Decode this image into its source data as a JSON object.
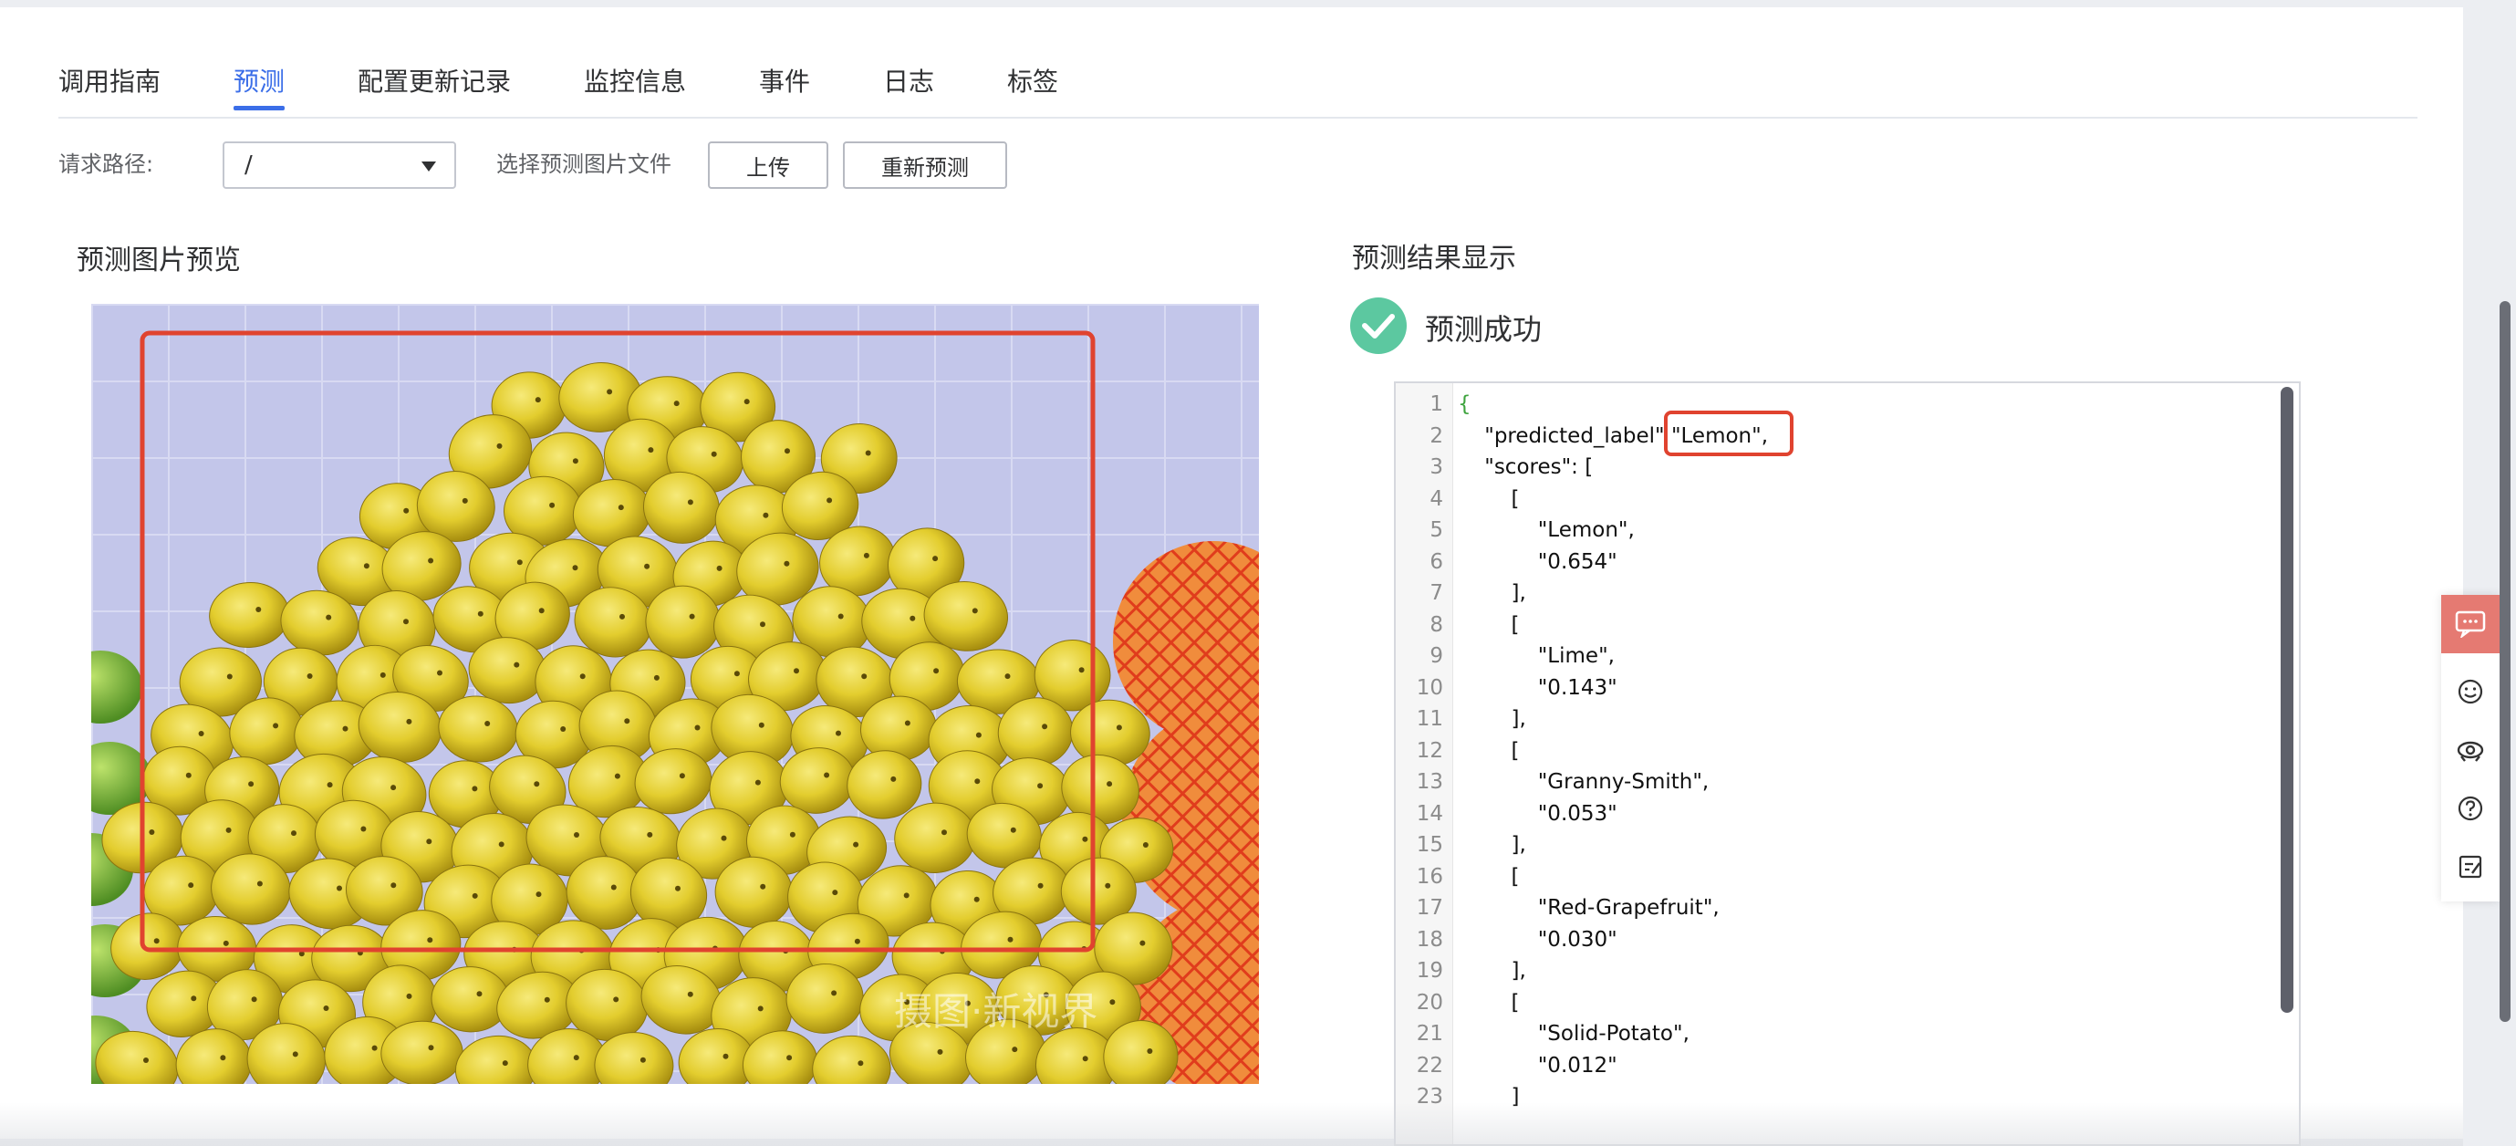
{
  "tabs": [
    {
      "label": "调用指南"
    },
    {
      "label": "预测"
    },
    {
      "label": "配置更新记录"
    },
    {
      "label": "监控信息"
    },
    {
      "label": "事件"
    },
    {
      "label": "日志"
    },
    {
      "label": "标签"
    }
  ],
  "active_tab": "预测",
  "toolbar": {
    "path_label": "请求路径:",
    "path_value": "/",
    "file_label": "选择预测图片文件",
    "upload_label": "上传",
    "repredict_label": "重新预测"
  },
  "preview": {
    "title": "预测图片预览",
    "watermark": "摄图·新视界"
  },
  "result": {
    "title": "预测结果显示",
    "status": "预测成功",
    "lines": [
      {
        "n": "1",
        "text": "{"
      },
      {
        "n": "2",
        "text": "    \"predicted_label\" \"Lemon\","
      },
      {
        "n": "3",
        "text": "    \"scores\": ["
      },
      {
        "n": "4",
        "text": "        ["
      },
      {
        "n": "5",
        "text": "            \"Lemon\","
      },
      {
        "n": "6",
        "text": "            \"0.654\""
      },
      {
        "n": "7",
        "text": "        ],"
      },
      {
        "n": "8",
        "text": "        ["
      },
      {
        "n": "9",
        "text": "            \"Lime\","
      },
      {
        "n": "10",
        "text": "            \"0.143\""
      },
      {
        "n": "11",
        "text": "        ],"
      },
      {
        "n": "12",
        "text": "        ["
      },
      {
        "n": "13",
        "text": "            \"Granny-Smith\","
      },
      {
        "n": "14",
        "text": "            \"0.053\""
      },
      {
        "n": "15",
        "text": "        ],"
      },
      {
        "n": "16",
        "text": "        ["
      },
      {
        "n": "17",
        "text": "            \"Red-Grapefruit\","
      },
      {
        "n": "18",
        "text": "            \"0.030\""
      },
      {
        "n": "19",
        "text": "        ],"
      },
      {
        "n": "20",
        "text": "        ["
      },
      {
        "n": "21",
        "text": "            \"Solid-Potato\","
      },
      {
        "n": "22",
        "text": "            \"0.012\""
      },
      {
        "n": "23",
        "text": "        ]"
      }
    ]
  },
  "colors": {
    "accent": "#3b6ee8",
    "success": "#5cc8a0",
    "annotation_red": "#e0432f",
    "float_active": "#e57a72"
  },
  "float_bar_icons": [
    "chat-icon",
    "smiley-icon",
    "headset-icon",
    "help-icon",
    "feedback-icon"
  ]
}
